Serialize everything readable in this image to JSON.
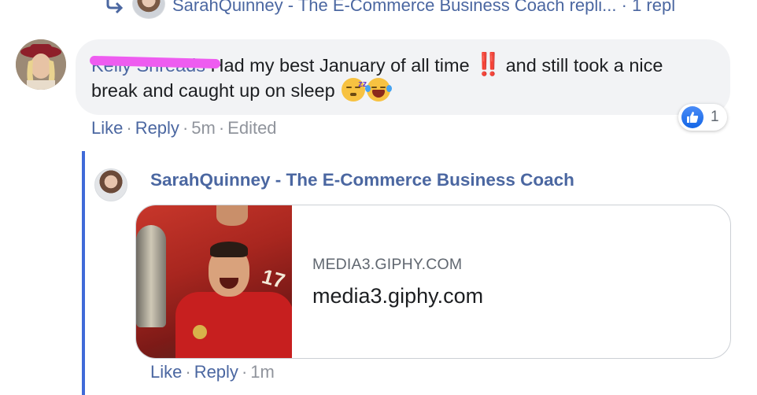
{
  "top_reply": {
    "text": "SarahQuinney - The E-Commerce Business Coach repli...",
    "count": "· 1 repl"
  },
  "comment": {
    "author": "Kelly Shreads",
    "text_part1": "Had my best January of all time",
    "bang": "‼️",
    "text_part2": "and still took a nice break and caught up on sleep",
    "reaction_count": "1",
    "meta": {
      "like": "Like",
      "reply": "Reply",
      "time": "5m",
      "edited": "Edited"
    }
  },
  "reply": {
    "author": "SarahQuinney - The E-Commerce Business Coach",
    "link_card": {
      "domain": "MEDIA3.GIPHY.COM",
      "title": "media3.giphy.com"
    },
    "meta": {
      "like": "Like",
      "reply": "Reply",
      "time": "1m"
    }
  },
  "colors": {
    "link_blue": "#4b67a1",
    "thread_bar": "#3f6ad8",
    "bubble_bg": "#f2f3f5",
    "redaction": "#ee5cf0"
  },
  "icons": {
    "reply_arrow": "reply-arrow-icon",
    "like_reaction": "thumbs-up-icon",
    "sleeping_emoji": "sleeping-face-icon",
    "laughing_emoji": "tears-of-joy-icon"
  }
}
